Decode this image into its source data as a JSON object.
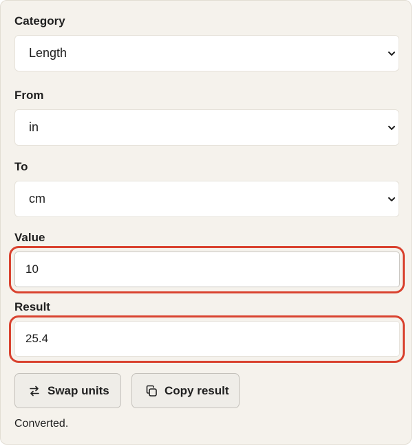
{
  "fields": {
    "category": {
      "label": "Category",
      "value": "Length"
    },
    "from": {
      "label": "From",
      "value": "in"
    },
    "to": {
      "label": "To",
      "value": "cm"
    },
    "value": {
      "label": "Value",
      "value": "10"
    },
    "result": {
      "label": "Result",
      "value": "25.4"
    }
  },
  "buttons": {
    "swap": {
      "label": "Swap units",
      "icon": "swap-arrows-icon"
    },
    "copy": {
      "label": "Copy result",
      "icon": "copy-icon"
    }
  },
  "status_text": "Converted.",
  "colors": {
    "panel_bg": "#f5f2ec",
    "highlight": "#d9422f",
    "button_bg": "#efede8"
  }
}
